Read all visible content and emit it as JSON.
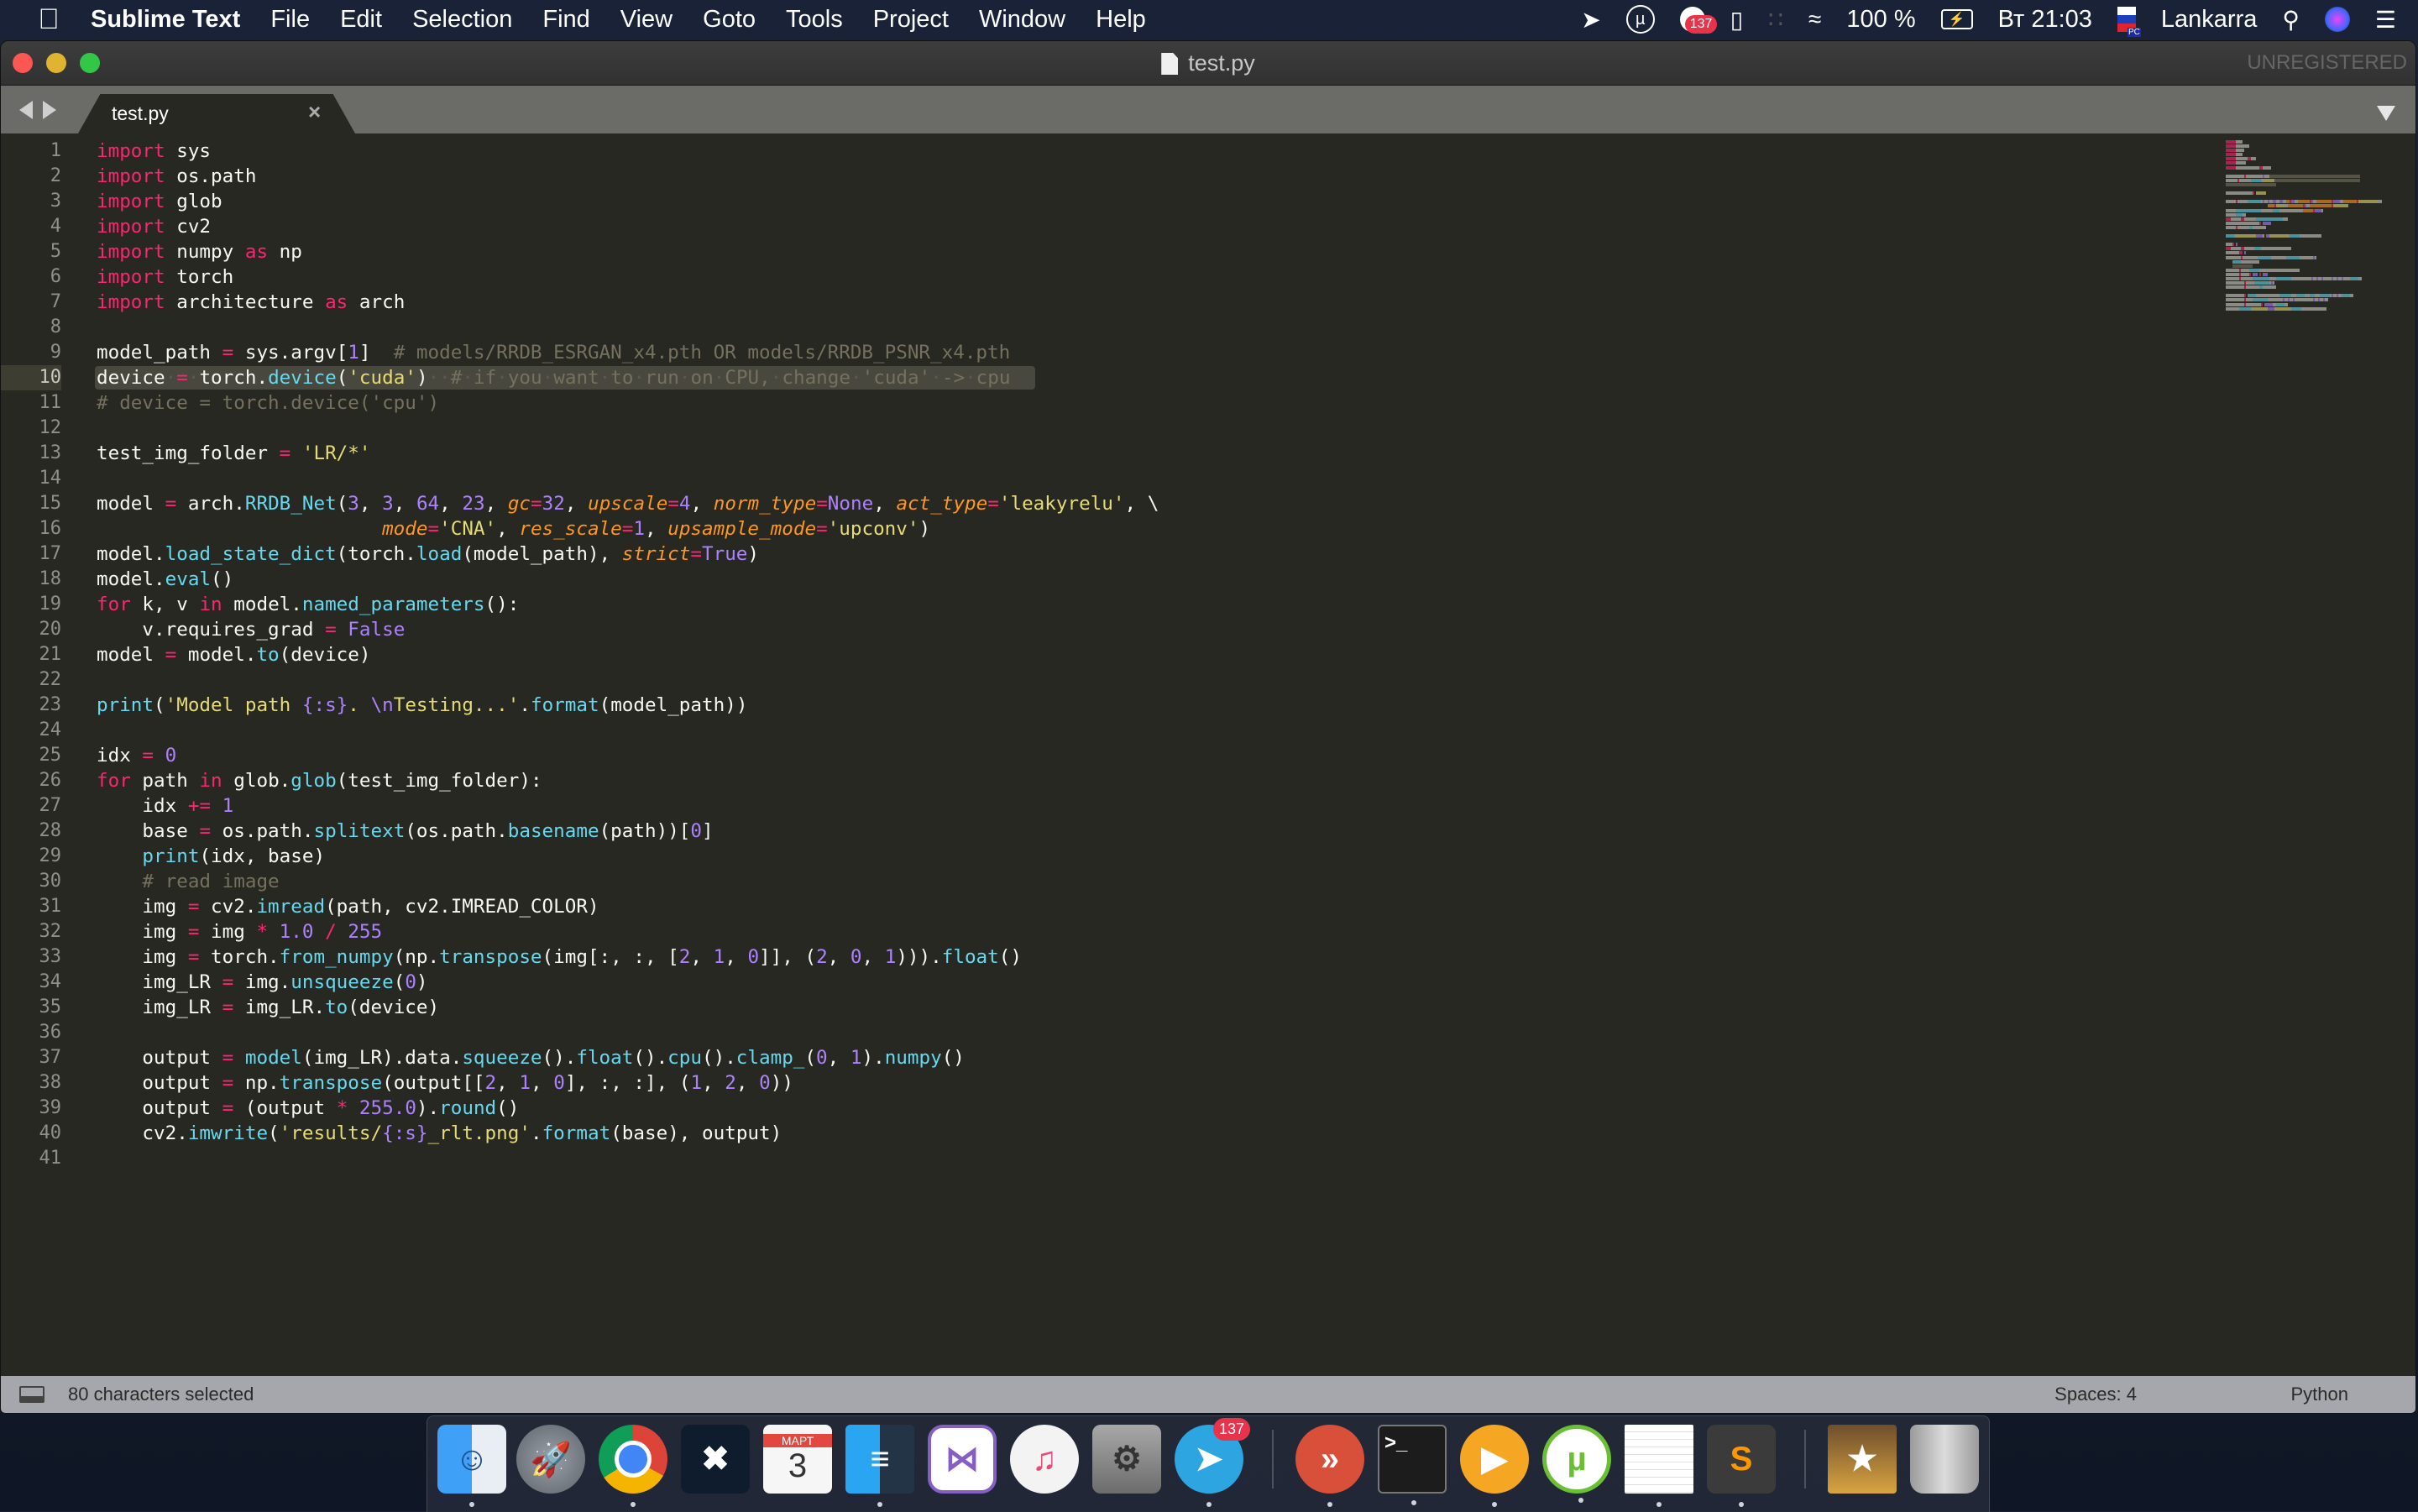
{
  "menubar": {
    "app_name": "Sublime Text",
    "items": [
      "File",
      "Edit",
      "Selection",
      "Find",
      "View",
      "Goto",
      "Tools",
      "Project",
      "Window",
      "Help"
    ],
    "status": {
      "mail_badge": "137",
      "battery": "100 %",
      "clock": "Вт 21:03",
      "input_source": "PC",
      "user": "Lankarra"
    }
  },
  "window": {
    "title": "test.py",
    "unregistered": "UNREGISTERED"
  },
  "tabs": [
    {
      "label": "test.py",
      "close": "×",
      "active": true
    }
  ],
  "editor": {
    "current_line": 10,
    "line_numbers": [
      "1",
      "2",
      "3",
      "4",
      "5",
      "6",
      "7",
      "8",
      "9",
      "10",
      "11",
      "12",
      "13",
      "14",
      "15",
      "16",
      "17",
      "18",
      "19",
      "20",
      "21",
      "22",
      "23",
      "24",
      "25",
      "26",
      "27",
      "28",
      "29",
      "30",
      "31",
      "32",
      "33",
      "34",
      "35",
      "36",
      "37",
      "38",
      "39",
      "40",
      "41"
    ],
    "lines": [
      [
        [
          "kw",
          "import"
        ],
        [
          "",
          "·sys"
        ]
      ],
      [
        [
          "kw",
          "import"
        ],
        [
          "",
          "·os.path"
        ]
      ],
      [
        [
          "kw",
          "import"
        ],
        [
          "",
          "·glob"
        ]
      ],
      [
        [
          "kw",
          "import"
        ],
        [
          "",
          "·cv2"
        ]
      ],
      [
        [
          "kw",
          "import"
        ],
        [
          "",
          "·numpy·"
        ],
        [
          "kw",
          "as"
        ],
        [
          "",
          "·np"
        ]
      ],
      [
        [
          "kw",
          "import"
        ],
        [
          "",
          "·torch"
        ]
      ],
      [
        [
          "kw",
          "import"
        ],
        [
          "",
          "·architecture·"
        ],
        [
          "kw",
          "as"
        ],
        [
          "",
          "·arch"
        ]
      ],
      [],
      [
        [
          "",
          "model_path·"
        ],
        [
          "op",
          "="
        ],
        [
          "",
          "·sys.argv["
        ],
        [
          "num",
          "1"
        ],
        [
          "",
          "]··"
        ],
        [
          "cmt",
          "#·models/RRDB_ESRGAN_x4.pth·OR·models/RRDB_PSNR_x4.pth"
        ]
      ],
      [
        [
          "",
          "device·"
        ],
        [
          "op",
          "="
        ],
        [
          "",
          "·torch."
        ],
        [
          "fn",
          "device"
        ],
        [
          "",
          "("
        ],
        [
          "str",
          "'cuda'"
        ],
        [
          "",
          ")"
        ],
        [
          "cmt",
          "··#·if·you·want·to·run·on·CPU,·change·'cuda'·->·cpu"
        ]
      ],
      [
        [
          "cmt",
          "#·device·=·torch.device('cpu')"
        ]
      ],
      [],
      [
        [
          "",
          "test_img_folder·"
        ],
        [
          "op",
          "="
        ],
        [
          "",
          "·"
        ],
        [
          "str",
          "'LR/*'"
        ]
      ],
      [],
      [
        [
          "",
          "model·"
        ],
        [
          "op",
          "="
        ],
        [
          "",
          "·arch."
        ],
        [
          "fn",
          "RRDB_Net"
        ],
        [
          "",
          "("
        ],
        [
          "num",
          "3"
        ],
        [
          "",
          ",·"
        ],
        [
          "num",
          "3"
        ],
        [
          "",
          ",·"
        ],
        [
          "num",
          "64"
        ],
        [
          "",
          ",·"
        ],
        [
          "num",
          "23"
        ],
        [
          "",
          ",·"
        ],
        [
          "arg",
          "gc"
        ],
        [
          "op",
          "="
        ],
        [
          "num",
          "32"
        ],
        [
          "",
          ",·"
        ],
        [
          "arg",
          "upscale"
        ],
        [
          "op",
          "="
        ],
        [
          "num",
          "4"
        ],
        [
          "",
          ",·"
        ],
        [
          "arg",
          "norm_type"
        ],
        [
          "op",
          "="
        ],
        [
          "const",
          "None"
        ],
        [
          "",
          ",·"
        ],
        [
          "arg",
          "act_type"
        ],
        [
          "op",
          "="
        ],
        [
          "str",
          "'leakyrelu'"
        ],
        [
          "",
          ",·\\"
        ]
      ],
      [
        [
          "",
          "·························"
        ],
        [
          "arg",
          "mode"
        ],
        [
          "op",
          "="
        ],
        [
          "str",
          "'CNA'"
        ],
        [
          "",
          ",·"
        ],
        [
          "arg",
          "res_scale"
        ],
        [
          "op",
          "="
        ],
        [
          "num",
          "1"
        ],
        [
          "",
          ",·"
        ],
        [
          "arg",
          "upsample_mode"
        ],
        [
          "op",
          "="
        ],
        [
          "str",
          "'upconv'"
        ],
        [
          "",
          ")"
        ]
      ],
      [
        [
          "",
          "model."
        ],
        [
          "fn",
          "load_state_dict"
        ],
        [
          "",
          "(torch."
        ],
        [
          "fn",
          "load"
        ],
        [
          "",
          "(model_path),·"
        ],
        [
          "arg",
          "strict"
        ],
        [
          "op",
          "="
        ],
        [
          "const",
          "True"
        ],
        [
          "",
          ")"
        ]
      ],
      [
        [
          "",
          "model."
        ],
        [
          "fn",
          "eval"
        ],
        [
          "",
          "()"
        ]
      ],
      [
        [
          "kw",
          "for"
        ],
        [
          "",
          "·k,·v·"
        ],
        [
          "kw",
          "in"
        ],
        [
          "",
          "·model."
        ],
        [
          "fn",
          "named_parameters"
        ],
        [
          "",
          "():"
        ]
      ],
      [
        [
          "",
          "····v.requires_grad·"
        ],
        [
          "op",
          "="
        ],
        [
          "",
          "·"
        ],
        [
          "const",
          "False"
        ]
      ],
      [
        [
          "",
          "model·"
        ],
        [
          "op",
          "="
        ],
        [
          "",
          "·model."
        ],
        [
          "fn",
          "to"
        ],
        [
          "",
          "(device)"
        ]
      ],
      [],
      [
        [
          "fn",
          "print"
        ],
        [
          "",
          "("
        ],
        [
          "str",
          "'Model·path·"
        ],
        [
          "num",
          "{:s}"
        ],
        [
          "str",
          "."
        ],
        [
          "str",
          "·"
        ],
        [
          "num",
          "\\n"
        ],
        [
          "str",
          "Testing...'"
        ],
        [
          "",
          "."
        ],
        [
          "fn",
          "format"
        ],
        [
          "",
          "(model_path))"
        ]
      ],
      [],
      [
        [
          "",
          "idx·"
        ],
        [
          "op",
          "="
        ],
        [
          "",
          "·"
        ],
        [
          "num",
          "0"
        ]
      ],
      [
        [
          "kw",
          "for"
        ],
        [
          "",
          "·path·"
        ],
        [
          "kw",
          "in"
        ],
        [
          "",
          "·glob."
        ],
        [
          "fn",
          "glob"
        ],
        [
          "",
          "(test_img_folder):"
        ]
      ],
      [
        [
          "",
          "····idx·"
        ],
        [
          "op",
          "+="
        ],
        [
          "",
          "·"
        ],
        [
          "num",
          "1"
        ]
      ],
      [
        [
          "",
          "····base·"
        ],
        [
          "op",
          "="
        ],
        [
          "",
          "·os.path."
        ],
        [
          "fn",
          "splitext"
        ],
        [
          "",
          "(os.path."
        ],
        [
          "fn",
          "basename"
        ],
        [
          "",
          "(path))["
        ],
        [
          "num",
          "0"
        ],
        [
          "",
          "]"
        ]
      ],
      [
        [
          "",
          "····"
        ],
        [
          "fn",
          "print"
        ],
        [
          "",
          "(idx,·base)"
        ]
      ],
      [
        [
          "",
          "····"
        ],
        [
          "cmt",
          "#·read·image"
        ]
      ],
      [
        [
          "",
          "····img·"
        ],
        [
          "op",
          "="
        ],
        [
          "",
          "·cv2."
        ],
        [
          "fn",
          "imread"
        ],
        [
          "",
          "(path,·cv2.IMREAD_COLOR)"
        ]
      ],
      [
        [
          "",
          "····img·"
        ],
        [
          "op",
          "="
        ],
        [
          "",
          "·img·"
        ],
        [
          "op",
          "*"
        ],
        [
          "",
          "·"
        ],
        [
          "num",
          "1.0"
        ],
        [
          "",
          "·"
        ],
        [
          "op",
          "/"
        ],
        [
          "",
          "·"
        ],
        [
          "num",
          "255"
        ]
      ],
      [
        [
          "",
          "····img·"
        ],
        [
          "op",
          "="
        ],
        [
          "",
          "·torch."
        ],
        [
          "fn",
          "from_numpy"
        ],
        [
          "",
          "(np."
        ],
        [
          "fn",
          "transpose"
        ],
        [
          "",
          "(img[:,·:,·["
        ],
        [
          "num",
          "2"
        ],
        [
          "",
          ",·"
        ],
        [
          "num",
          "1"
        ],
        [
          "",
          ",·"
        ],
        [
          "num",
          "0"
        ],
        [
          "",
          "]],·("
        ],
        [
          "num",
          "2"
        ],
        [
          "",
          ",·"
        ],
        [
          "num",
          "0"
        ],
        [
          "",
          ",·"
        ],
        [
          "num",
          "1"
        ],
        [
          "",
          ")))."
        ],
        [
          "fn",
          "float"
        ],
        [
          "",
          "()"
        ]
      ],
      [
        [
          "",
          "····img_LR·"
        ],
        [
          "op",
          "="
        ],
        [
          "",
          "·img."
        ],
        [
          "fn",
          "unsqueeze"
        ],
        [
          "",
          "("
        ],
        [
          "num",
          "0"
        ],
        [
          "",
          ")"
        ]
      ],
      [
        [
          "",
          "····img_LR·"
        ],
        [
          "op",
          "="
        ],
        [
          "",
          "·img_LR."
        ],
        [
          "fn",
          "to"
        ],
        [
          "",
          "(device)"
        ]
      ],
      [],
      [
        [
          "",
          "····output·"
        ],
        [
          "op",
          "="
        ],
        [
          "",
          "·"
        ],
        [
          "fn",
          "model"
        ],
        [
          "",
          "(img_LR).data."
        ],
        [
          "fn",
          "squeeze"
        ],
        [
          "",
          "()."
        ],
        [
          "fn",
          "float"
        ],
        [
          "",
          "()."
        ],
        [
          "fn",
          "cpu"
        ],
        [
          "",
          "()."
        ],
        [
          "fn",
          "clamp_"
        ],
        [
          "",
          "("
        ],
        [
          "num",
          "0"
        ],
        [
          "",
          ",·"
        ],
        [
          "num",
          "1"
        ],
        [
          "",
          ")."
        ],
        [
          "fn",
          "numpy"
        ],
        [
          "",
          "()"
        ]
      ],
      [
        [
          "",
          "····output·"
        ],
        [
          "op",
          "="
        ],
        [
          "",
          "·np."
        ],
        [
          "fn",
          "transpose"
        ],
        [
          "",
          "(output[["
        ],
        [
          "num",
          "2"
        ],
        [
          "",
          ",·"
        ],
        [
          "num",
          "1"
        ],
        [
          "",
          ",·"
        ],
        [
          "num",
          "0"
        ],
        [
          "",
          "],·:,·:],·("
        ],
        [
          "num",
          "1"
        ],
        [
          "",
          ",·"
        ],
        [
          "num",
          "2"
        ],
        [
          "",
          ",·"
        ],
        [
          "num",
          "0"
        ],
        [
          "",
          "))"
        ]
      ],
      [
        [
          "",
          "····output·"
        ],
        [
          "op",
          "="
        ],
        [
          "",
          "·(output·"
        ],
        [
          "op",
          "*"
        ],
        [
          "",
          "·"
        ],
        [
          "num",
          "255.0"
        ],
        [
          "",
          ")."
        ],
        [
          "fn",
          "round"
        ],
        [
          "",
          "()"
        ]
      ],
      [
        [
          "",
          "····cv2."
        ],
        [
          "fn",
          "imwrite"
        ],
        [
          "",
          "("
        ],
        [
          "str",
          "'results/"
        ],
        [
          "num",
          "{:s}"
        ],
        [
          "str",
          "_rlt.png'"
        ],
        [
          "",
          "."
        ],
        [
          "fn",
          "format"
        ],
        [
          "",
          "(base),·output)"
        ]
      ],
      []
    ]
  },
  "statusbar": {
    "selection": "80 characters selected",
    "indentation": "Spaces: 4",
    "syntax": "Python"
  },
  "dock": {
    "calendar_month": "МАРТ",
    "calendar_day": "3",
    "telegram_badge": "137",
    "items": [
      "Finder",
      "Launchpad",
      "Google Chrome",
      "Cross",
      "Calendar",
      "Commander One",
      "Visual Studio",
      "iTunes",
      "System Preferences",
      "Telegram",
      "Remote Desktop",
      "Terminal",
      "Infuse",
      "uTorrent",
      "TextEdit",
      "Sublime Text",
      "Downloads",
      "Trash"
    ]
  },
  "colors": {
    "editor_bg": "#272822",
    "keyword": "#f92672",
    "function": "#66d9ef",
    "string": "#e6db74",
    "number": "#ae81ff",
    "comment": "#75715e",
    "argument": "#fd971f",
    "selection": "#49483e"
  }
}
